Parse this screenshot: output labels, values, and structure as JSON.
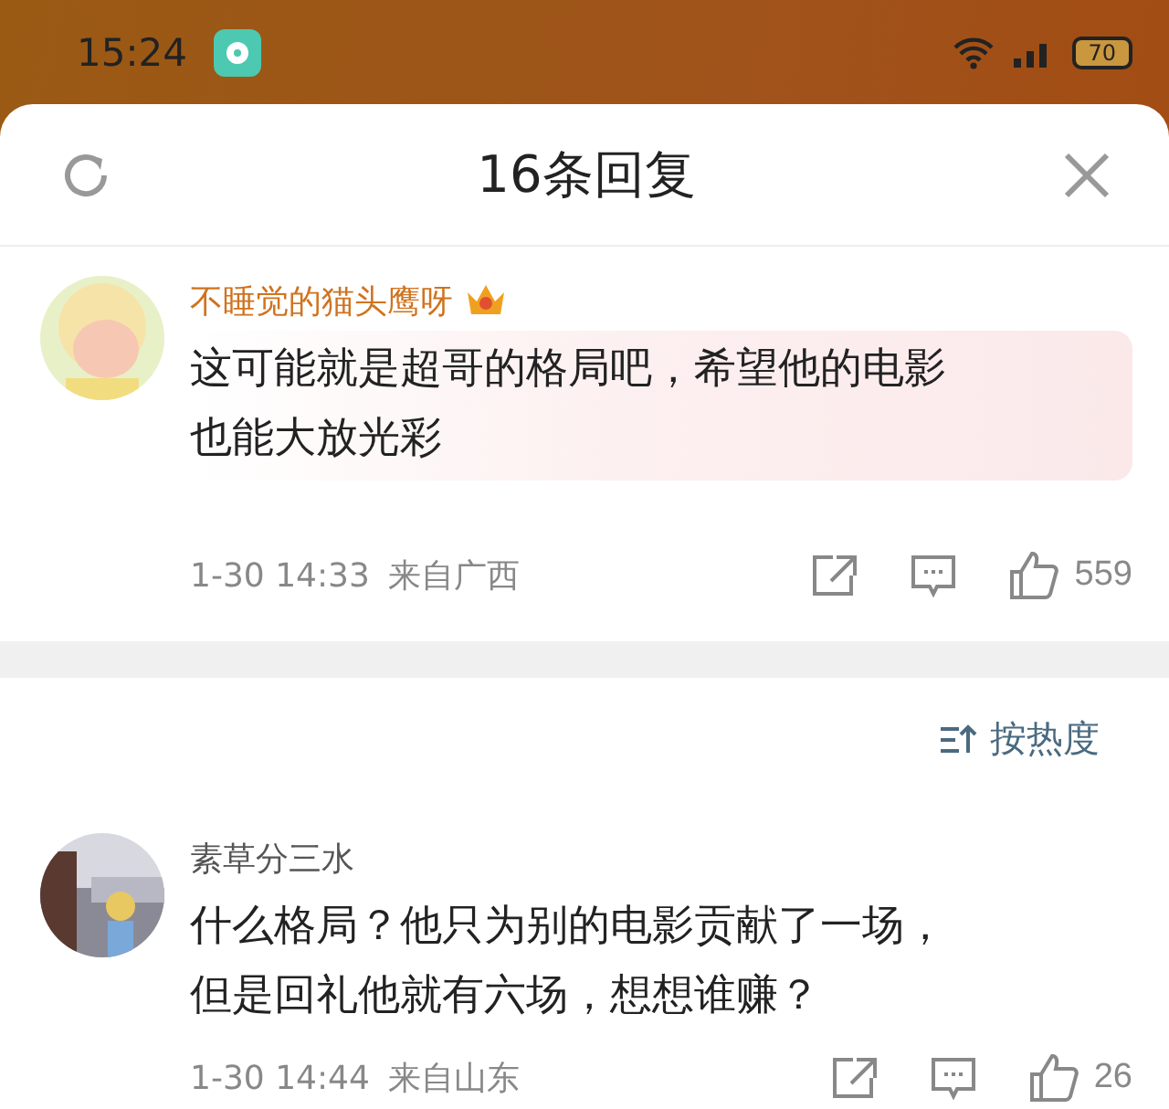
{
  "status_bar": {
    "time": "15:24",
    "battery": "70"
  },
  "header": {
    "title": "16条回复"
  },
  "comments": [
    {
      "author": "不睡觉的猫头鹰呀",
      "vip": true,
      "highlighted": true,
      "text_lines": [
        "这可能就是超哥的格局吧，希望他的电影",
        "也能大放光彩"
      ],
      "time": "1-30 14:33",
      "location": "来自广西",
      "likes": "559"
    },
    {
      "author": "素草分三水",
      "vip": false,
      "highlighted": false,
      "text_lines": [
        "什么格局？他只为别的电影贡献了一场，",
        "但是回礼他就有六场，想想谁赚？"
      ],
      "time": "1-30 14:44",
      "location": "来自山东",
      "likes": "26"
    }
  ],
  "sort": {
    "label": "按热度"
  }
}
